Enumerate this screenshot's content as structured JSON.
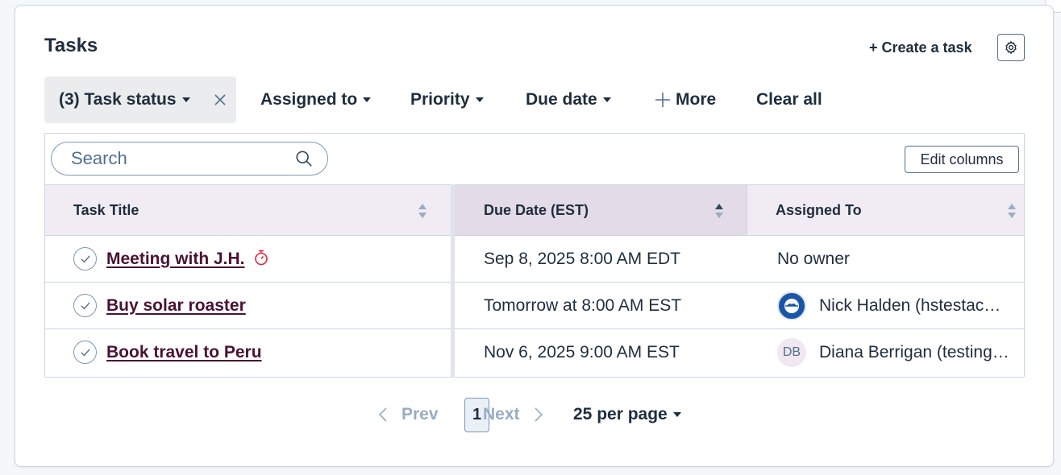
{
  "header": {
    "title": "Tasks",
    "create_label": "+ Create a task"
  },
  "filters": {
    "task_status": "(3) Task status",
    "assigned_to": "Assigned to",
    "priority": "Priority",
    "due_date": "Due date",
    "more": "More",
    "clear_all": "Clear all"
  },
  "search": {
    "placeholder": "Search",
    "value": ""
  },
  "toolbar": {
    "edit_columns_label": "Edit columns"
  },
  "table": {
    "columns": [
      {
        "label": "Task Title",
        "sort": "none"
      },
      {
        "label": "Due Date (EST)",
        "sort": "active"
      },
      {
        "label": "Assigned To",
        "sort": "none"
      }
    ],
    "rows": [
      {
        "title": "Meeting with J.H.",
        "due": "Sep 8, 2025 8:00 AM EDT",
        "owner": "No owner",
        "overdue_icon": "timer-icon"
      },
      {
        "title": "Buy solar roaster",
        "due": "Tomorrow at 8:00 AM EST",
        "owner": "Nick Halden (hstestac…",
        "owner_avatar": "logo-avatar"
      },
      {
        "title": "Book travel to Peru",
        "due": "Nov 6, 2025 9:00 AM EST",
        "owner": "Diana Berrigan (testing…",
        "owner_initials": "DB"
      }
    ]
  },
  "pagination": {
    "prev": "Prev",
    "current_page": "1",
    "next": "Next",
    "per_page": "25 per page"
  },
  "colors": {
    "link": "#4a1232",
    "header_bg": "#f1ecf3",
    "sorted_header_bg": "#e4dbe8",
    "timer_icon": "#e5243b",
    "avatar_blue": "#1a56a8"
  }
}
